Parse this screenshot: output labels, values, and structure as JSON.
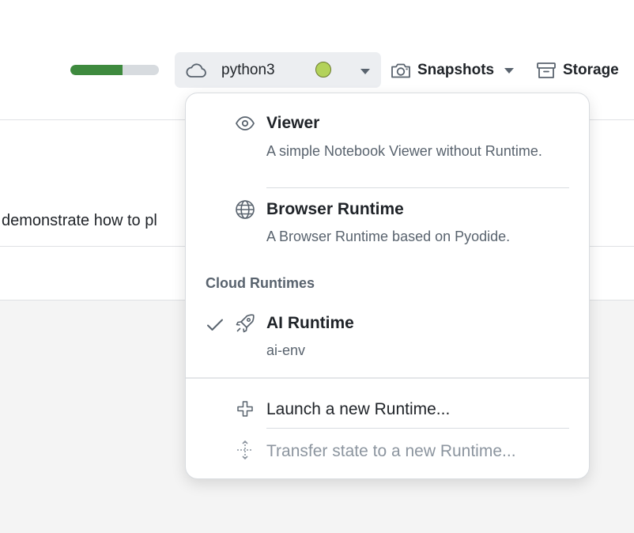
{
  "toolbar": {
    "progress_fraction": 0.59,
    "kernel_name": "python3",
    "kernel_status_color": "#b3d25a",
    "kernel_icon": "cloud-icon",
    "snapshots_label": "Snapshots",
    "snapshots_icon": "camera-icon",
    "storage_label": "Storage",
    "storage_icon": "archive-box-icon"
  },
  "notebook": {
    "text_line": "demonstrate how to pl"
  },
  "menu": {
    "items": [
      {
        "title": "Viewer",
        "description": "A simple Notebook Viewer without Runtime.",
        "icon": "eye-icon"
      },
      {
        "title": "Browser Runtime",
        "description": "A Browser Runtime based on Pyodide.",
        "icon": "globe-icon"
      }
    ],
    "cloud_section_header": "Cloud Runtimes",
    "cloud_items": [
      {
        "title": "AI Runtime",
        "description": "ai-env",
        "icon": "rocket-icon",
        "selected": true
      }
    ],
    "actions": [
      {
        "label": "Launch a new Runtime...",
        "icon": "plus-icon",
        "enabled": true
      },
      {
        "label": "Transfer state to a new Runtime...",
        "icon": "transfer-icon",
        "enabled": false
      }
    ]
  },
  "colors": {
    "progress_fill": "#3e8a3e",
    "muted_text": "#59636e",
    "disabled_text": "#8c959f"
  }
}
